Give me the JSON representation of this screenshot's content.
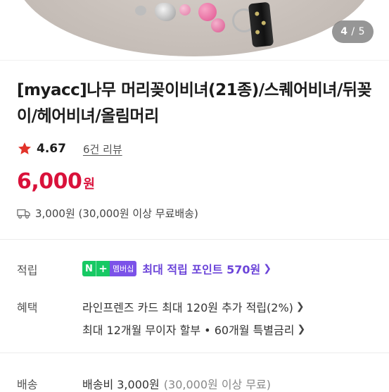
{
  "gallery": {
    "current": "4",
    "separator": " / ",
    "total": "5"
  },
  "product": {
    "title": "[myacc]나무 머리꽂이비녀(21종)/스퀘어비녀/뒤꽂이/헤어비녀/올림머리",
    "rating": "4.67",
    "review_link": "6건 리뷰",
    "price": "6,000",
    "price_unit": "원",
    "shipping_note": "3,000원 (30,000원 이상 무료배송)"
  },
  "benefits": {
    "points": {
      "label": "적립",
      "badge_n": "N",
      "badge_plus": "+",
      "badge_text": "멤버십",
      "text": "최대 적립 포인트 570원"
    },
    "perks": {
      "label": "혜택",
      "line1": "라인프렌즈 카드 최대 120원 추가 적립(2%)",
      "line2": "최대 12개월 무이자 할부 • 60개월 특별금리"
    },
    "delivery": {
      "label": "배송",
      "fee": "배송비 3,000원",
      "note": "(30,000원 이상 무료)"
    }
  },
  "icons": {
    "star": "star-icon",
    "truck": "truck-icon",
    "chevron": "chevron-right-icon"
  },
  "colors": {
    "price_red": "#d9113a",
    "star_red": "#e2332a",
    "membership_purple": "#6c45d9",
    "naver_green": "#17c964"
  }
}
